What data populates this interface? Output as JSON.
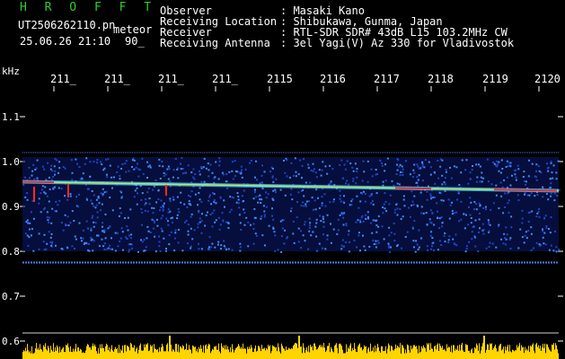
{
  "header": {
    "logo": "H R O F F T",
    "filename": "UT2506262110.pn",
    "meteor": "meteor",
    "datetime": "25.06.26 21:10",
    "count": "90_",
    "fields": [
      {
        "label": "Observer",
        "value": ": Masaki Kano"
      },
      {
        "label": "Receiving Location",
        "value": ": Shibukawa, Gunma, Japan"
      },
      {
        "label": "Receiver",
        "value": ": RTL-SDR SDR# 43dB L15 103.2MHz CW"
      },
      {
        "label": "Receiving Antenna",
        "value": ": 3el Yagi(V) Az 330 for Vladivostok"
      }
    ]
  },
  "chart_data": {
    "type": "heatmap",
    "title": "",
    "xlabel": "",
    "ylabel": "kHz",
    "x_ticks": [
      "211_",
      "211_",
      "211_",
      "211_",
      "2115",
      "2116",
      "2117",
      "2118",
      "2119",
      "2120"
    ],
    "y_ticks": [
      {
        "value": 1.1,
        "label": "1.1"
      },
      {
        "value": 1.0,
        "label": "1.0"
      },
      {
        "value": 0.9,
        "label": "0.9"
      },
      {
        "value": 0.8,
        "label": "0.8"
      },
      {
        "value": 0.7,
        "label": "0.7"
      },
      {
        "value": 0.6,
        "label": "0.6"
      }
    ],
    "ylim": [
      0.6,
      1.15
    ],
    "grid": false,
    "colors": {
      "background": "#000000",
      "noise_low": "#0a1a6e",
      "noise_high": "#3f8cff",
      "carrier": "#ff2a2a",
      "activity_bars": "#ffd400",
      "tick": "#ffffff",
      "boundary_line": "#4a7cff"
    },
    "signal_band_khz": [
      0.8,
      1.01
    ],
    "noise_edges_khz": [
      0.775,
      1.02
    ],
    "carrier_khz_start": 0.955,
    "carrier_khz_end": 0.935
  }
}
